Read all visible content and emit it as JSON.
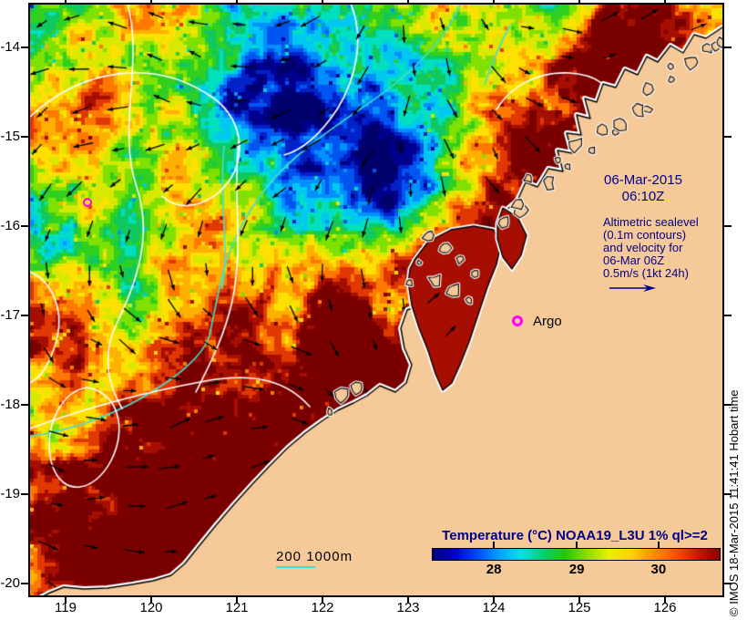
{
  "annotations": {
    "datetime": {
      "line1": "06-Mar-2015",
      "line2": "06:10Z",
      "color": "#00008B"
    },
    "altimetric": {
      "lines": [
        "Altimetric sealevel",
        "(0.1m contours)",
        "and velocity for",
        "06-Mar 06Z",
        "0.5m/s (1kt 24h)"
      ],
      "color": "#00008B"
    },
    "argo": {
      "label": "Argo",
      "marker_color": "#FF00FF"
    },
    "depth_scale": {
      "label": "200 1000m",
      "line_color": "#40E0D0"
    },
    "copyright": "© IMOS 18-Mar-2015 11:41:41 Hobart time"
  },
  "colorbar": {
    "title": "Temperature (°C) NOAA19_L3U 1% ql>=2",
    "title_color": "#00008B",
    "ticks": [
      "28",
      "29",
      "30"
    ],
    "tick_fractions": [
      0.213,
      0.502,
      0.787
    ],
    "gradient": [
      "#000080",
      "#0000C8",
      "#0048FF",
      "#00A0FF",
      "#00E0E8",
      "#00D070",
      "#28C800",
      "#90DC00",
      "#E8F000",
      "#FFD000",
      "#FF9000",
      "#FF5000",
      "#C81800",
      "#8B0000"
    ]
  },
  "axes": {
    "lat_ticks": [
      "-14",
      "-15",
      "-16",
      "-17",
      "-18",
      "-19",
      "-20"
    ],
    "lon_ticks": [
      "119",
      "120",
      "121",
      "122",
      "123",
      "124",
      "125",
      "126"
    ]
  },
  "map": {
    "land_color": "#F6C998",
    "gulf_water_color": "#A50E00",
    "coast_halo_color": "#FFFFFF",
    "coast_line_color": "#000000",
    "sealevel_contour_color": "#FFFFFF",
    "depth_contour_color": "#40E0D0",
    "vector_color": "#000000",
    "sea_palette": [
      "#00006B",
      "#000090",
      "#0022C8",
      "#0055F0",
      "#0090FF",
      "#00C8F0",
      "#00E0C0",
      "#10C860",
      "#30D020",
      "#80E000",
      "#D8E800",
      "#FFE000",
      "#FFB000",
      "#FF7800",
      "#E03800",
      "#A50E00",
      "#7A0000"
    ]
  }
}
